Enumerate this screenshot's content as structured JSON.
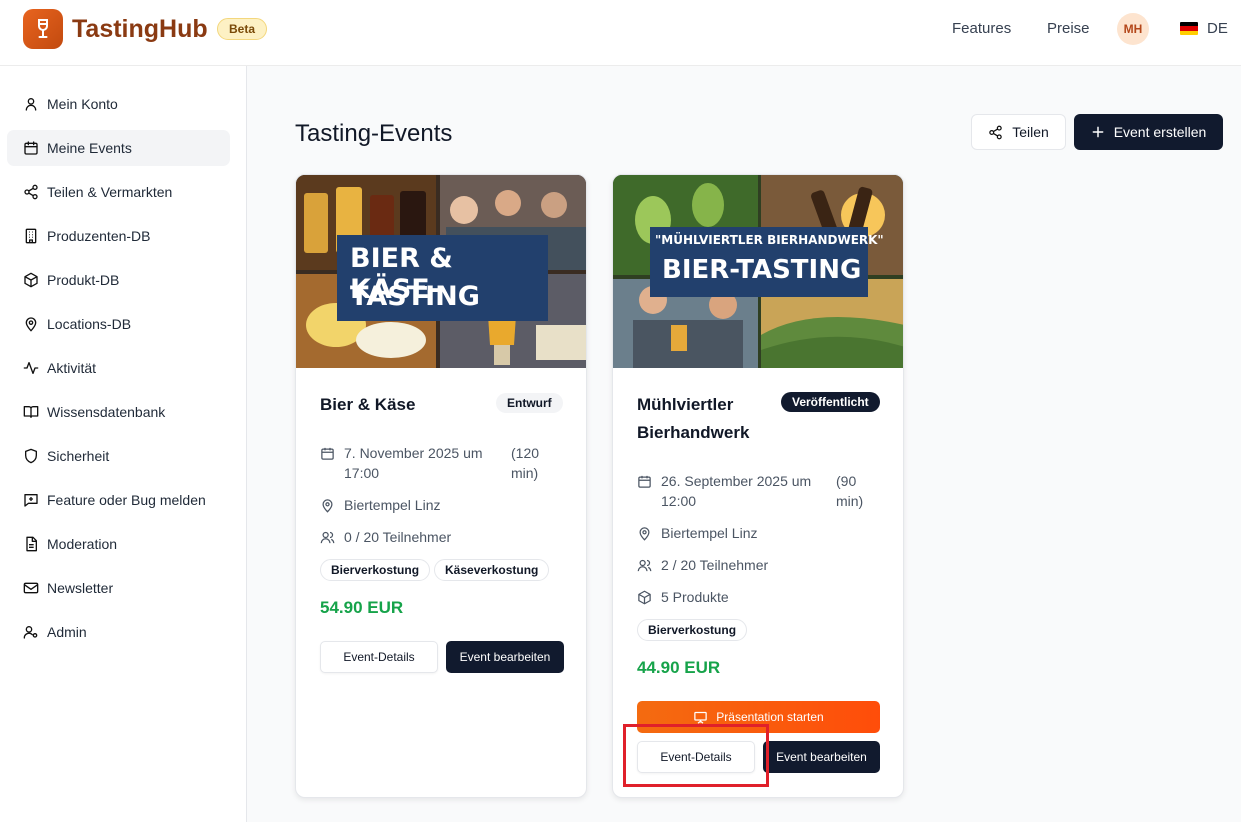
{
  "header": {
    "brand": "TastingHub",
    "beta": "Beta",
    "nav": [
      "Features",
      "Preise"
    ],
    "avatar_initials": "MH",
    "language": "DE"
  },
  "sidebar": {
    "items": [
      {
        "label": "Mein Konto",
        "icon": "user-icon"
      },
      {
        "label": "Meine Events",
        "icon": "calendar-icon",
        "active": true
      },
      {
        "label": "Teilen & Vermarkten",
        "icon": "share-icon"
      },
      {
        "label": "Produzenten-DB",
        "icon": "building-icon"
      },
      {
        "label": "Produkt-DB",
        "icon": "package-icon"
      },
      {
        "label": "Locations-DB",
        "icon": "map-pin-icon"
      },
      {
        "label": "Aktivität",
        "icon": "activity-icon"
      },
      {
        "label": "Wissensdatenbank",
        "icon": "book-icon"
      },
      {
        "label": "Sicherheit",
        "icon": "shield-icon"
      },
      {
        "label": "Feature oder Bug melden",
        "icon": "message-plus-icon"
      },
      {
        "label": "Moderation",
        "icon": "file-text-icon"
      },
      {
        "label": "Newsletter",
        "icon": "mail-icon"
      },
      {
        "label": "Admin",
        "icon": "user-cog-icon"
      }
    ]
  },
  "main": {
    "title": "Tasting-Events",
    "share_label": "Teilen",
    "create_label": "Event erstellen"
  },
  "events": [
    {
      "image_banner": [
        "BIER & KÄSE-",
        "TASTING"
      ],
      "title": "Bier & Käse",
      "status": "Entwurf",
      "date_line1": "7. November 2025 um",
      "date_line2": "17:00",
      "duration_line1": "(120",
      "duration_line2": "min)",
      "location": "Biertempel Linz",
      "participants": "0 / 20 Teilnehmer",
      "tags": [
        "Bierverkostung",
        "Käseverkostung"
      ],
      "price": "54.90 EUR",
      "details_label": "Event-Details",
      "edit_label": "Event bearbeiten"
    },
    {
      "image_banner": [
        "\"MÜHLVIERTLER BIERHANDWERK\"",
        "BIER-TASTING"
      ],
      "title_line1": "Mühlviertler",
      "title_line2": "Bierhandwerk",
      "status": "Veröffentlicht",
      "date_line1": "26. September 2025 um",
      "date_line2": "12:00",
      "duration_line1": "(90",
      "duration_line2": "min)",
      "location": "Biertempel Linz",
      "participants": "2 / 20 Teilnehmer",
      "products": "5 Produkte",
      "tags": [
        "Bierverkostung"
      ],
      "price": "44.90 EUR",
      "presentation_label": "Präsentation starten",
      "details_label": "Event-Details",
      "edit_label": "Event bearbeiten"
    }
  ],
  "colors": {
    "brand": "#8a3a12",
    "accent_orange": "#f46b10",
    "dark_button": "#111a2e",
    "price_green": "#16a34a",
    "highlight_red": "#e0202a"
  }
}
